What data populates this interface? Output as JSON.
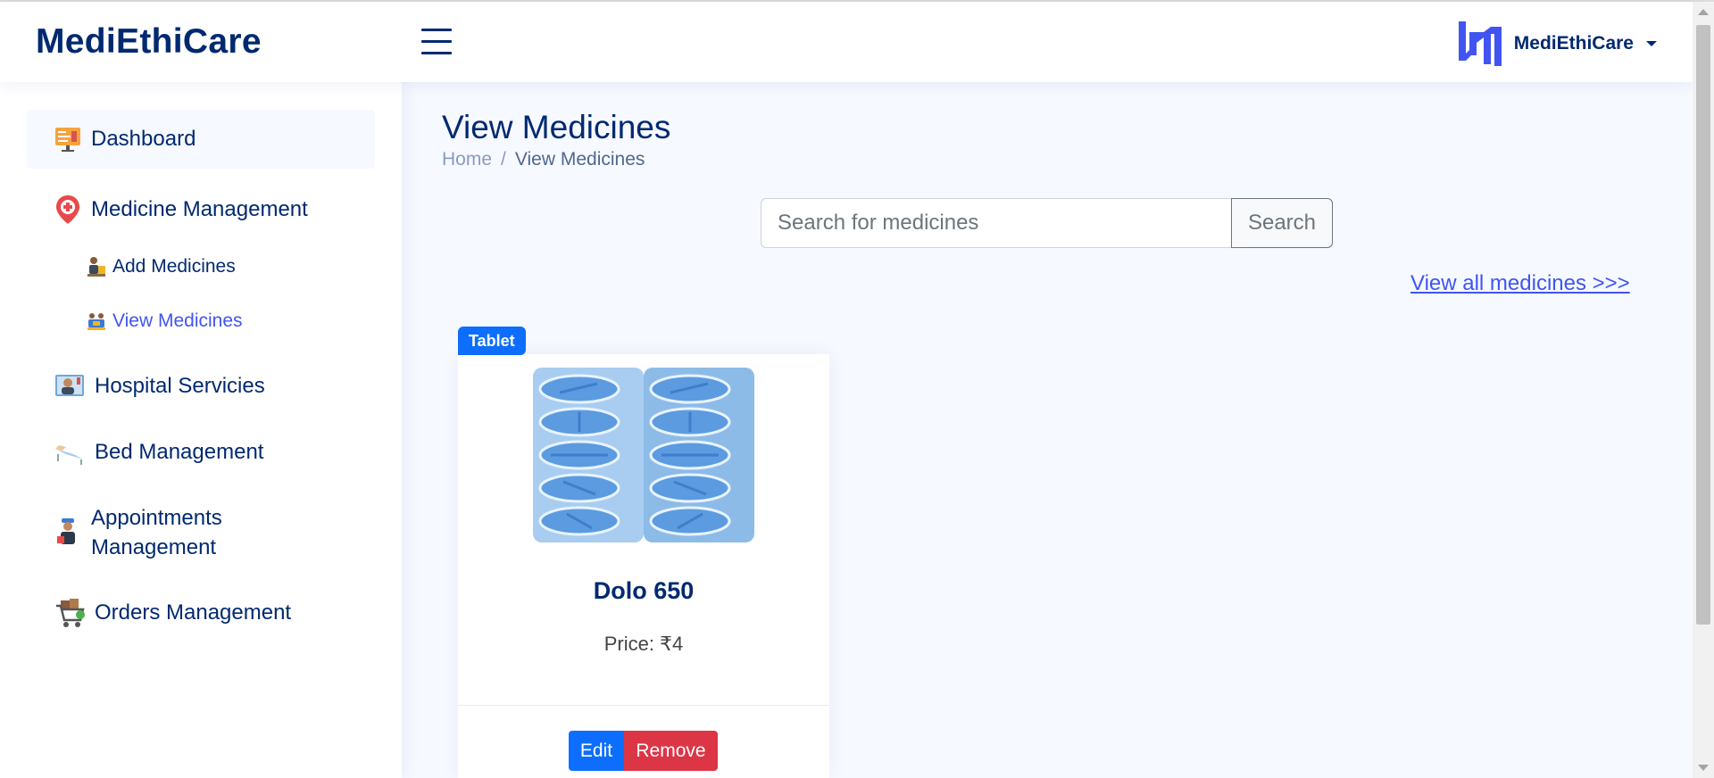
{
  "header": {
    "brand": "MediEthiCare",
    "profile_name": "MediEthiCare"
  },
  "sidebar": {
    "items": [
      {
        "label": "Dashboard",
        "icon": "dashboard-icon"
      },
      {
        "label": "Medicine Management",
        "icon": "medical-pin-icon"
      },
      {
        "label": "Add Medicines",
        "icon": "add-medicines-icon"
      },
      {
        "label": "View Medicines",
        "icon": "view-medicines-icon"
      },
      {
        "label": "Hospital Servicies",
        "icon": "hospital-services-icon"
      },
      {
        "label": "Bed Management",
        "icon": "bed-icon"
      },
      {
        "label": "Appointments Management",
        "icon": "appointments-icon"
      },
      {
        "label": "Orders Management",
        "icon": "cart-icon"
      }
    ]
  },
  "main": {
    "title": "View Medicines",
    "breadcrumb": {
      "home": "Home",
      "separator": "/",
      "current": "View Medicines"
    },
    "search": {
      "placeholder": "Search for medicines",
      "button": "Search"
    },
    "view_all": "View all medicines >>>",
    "medicines": [
      {
        "badge": "Tablet",
        "name": "Dolo 650",
        "price": "Price: ₹4",
        "edit": "Edit",
        "remove": "Remove"
      }
    ]
  },
  "colors": {
    "primary": "#012970",
    "accent": "#4154f1",
    "background": "#f6f9ff",
    "badge": "#0d6efd",
    "danger": "#dc3545"
  }
}
